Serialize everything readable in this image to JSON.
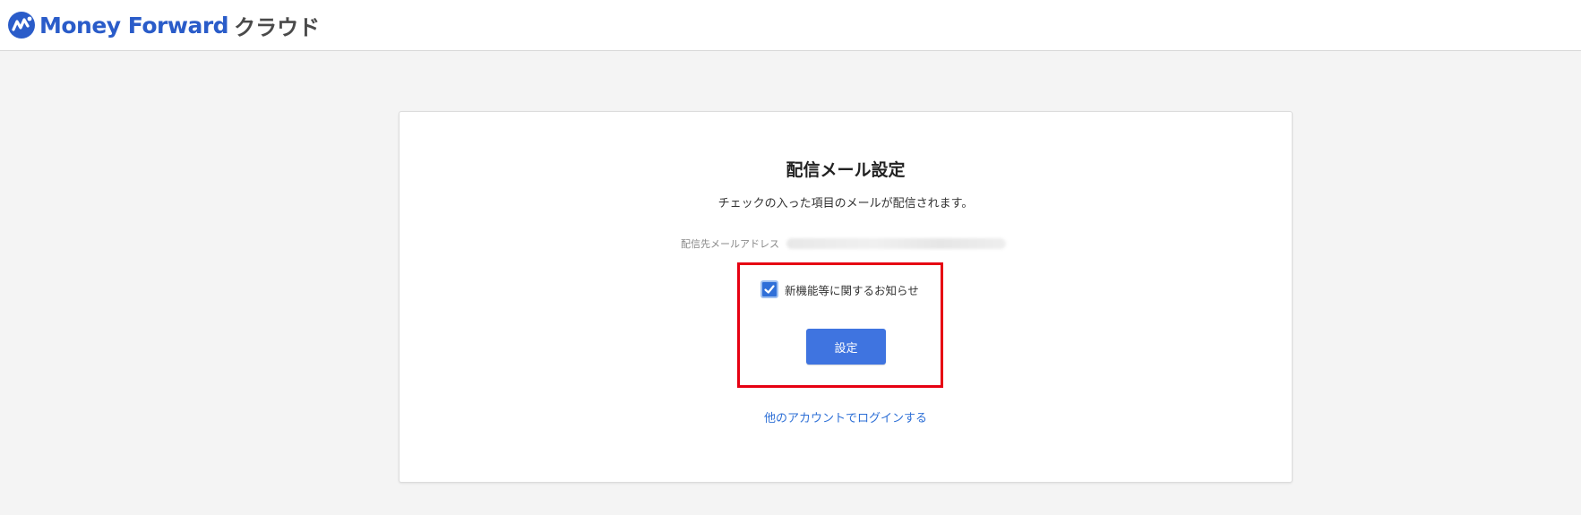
{
  "header": {
    "brand_name": "Money Forward",
    "brand_suffix": "クラウド",
    "logo_icon": "money-forward-logo-icon",
    "brand_color": "#2a5cc9"
  },
  "card": {
    "title": "配信メール設定",
    "description": "チェックの入った項目のメールが配信されます。",
    "email_label": "配信先メールアドレス",
    "email_value": "",
    "options": [
      {
        "label": "新機能等に関するお知らせ",
        "checked": true
      }
    ],
    "submit_label": "設定",
    "other_account_link": "他のアカウントでログインする"
  },
  "colors": {
    "accent": "#3f74e0",
    "link": "#2d6fd6",
    "highlight": "#e60012",
    "background": "#f4f4f4"
  }
}
